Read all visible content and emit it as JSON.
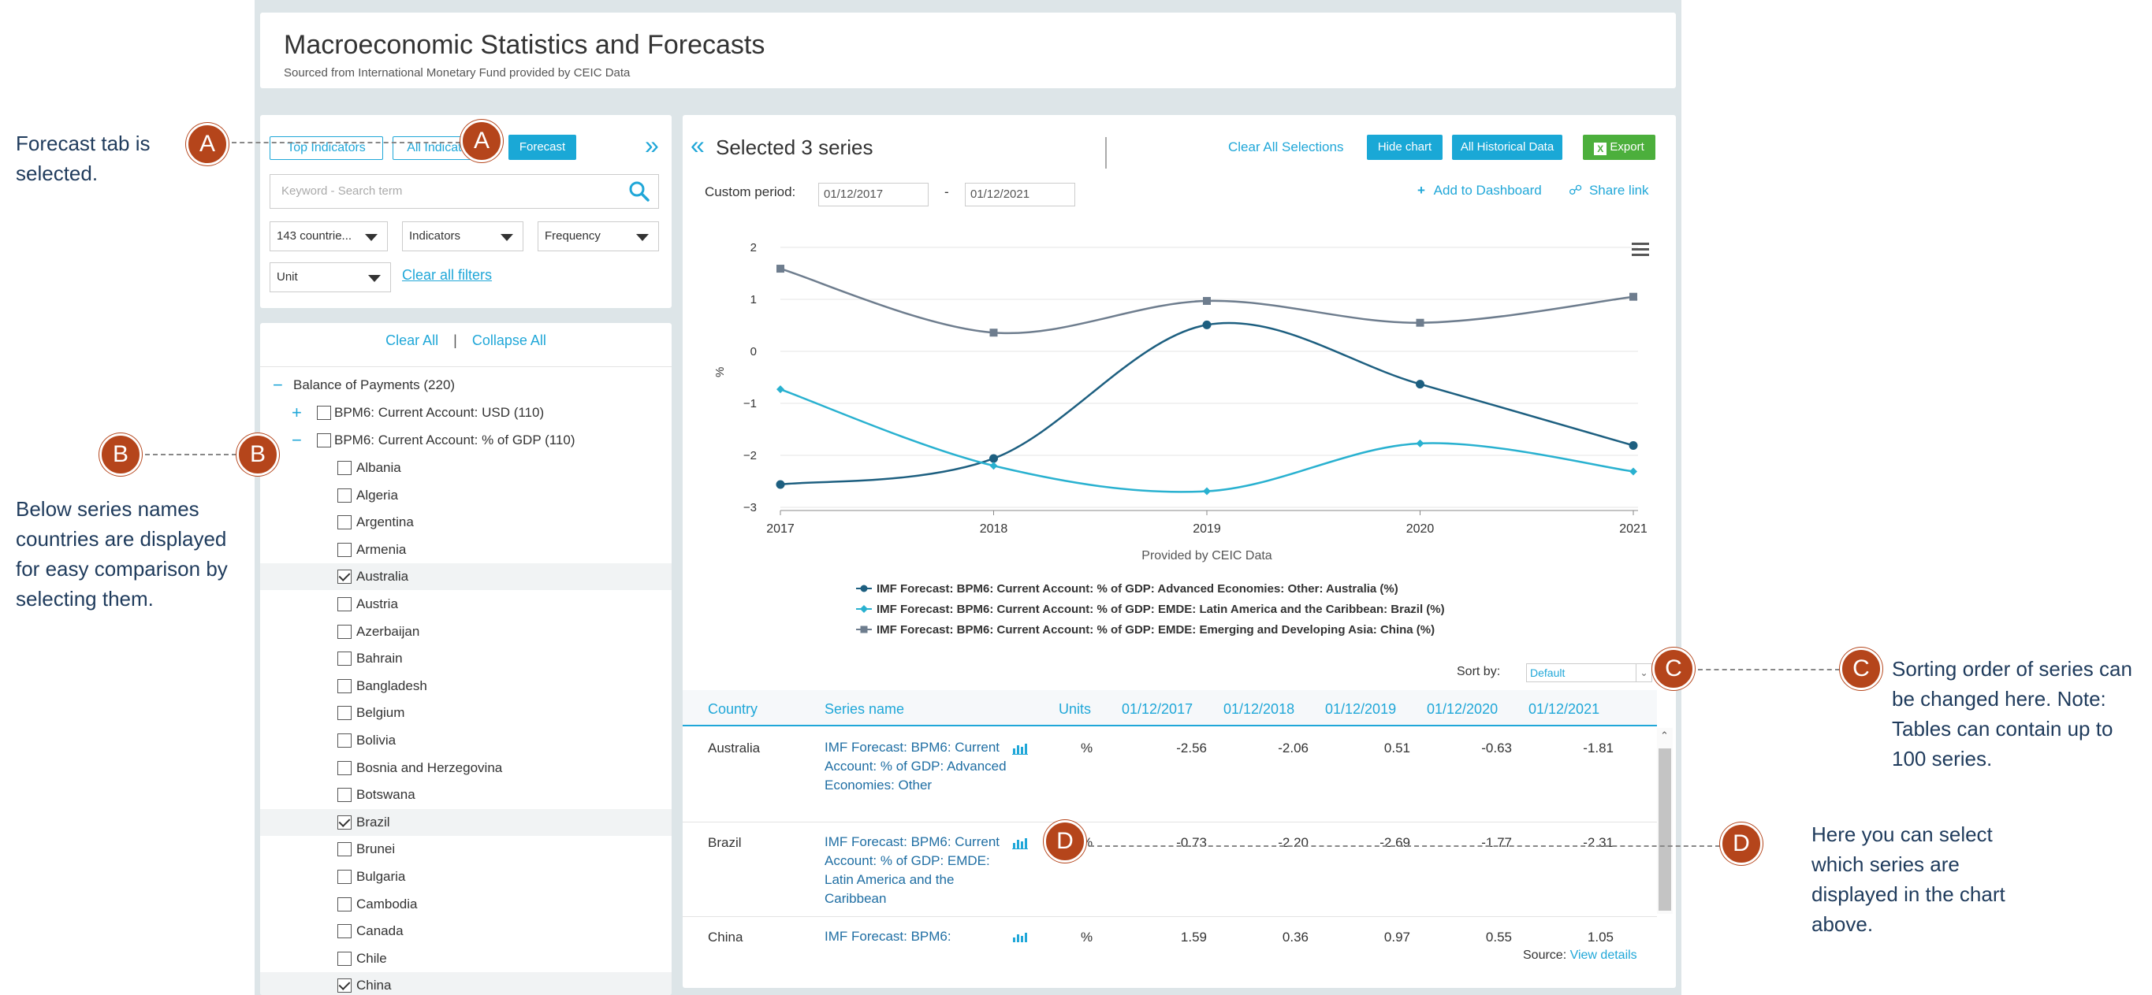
{
  "header": {
    "title": "Macroeconomic Statistics and Forecasts",
    "subtitle": "Sourced from International Monetary Fund provided by CEIC Data"
  },
  "filters": {
    "tabs": [
      "Top Indicators",
      "All Indicators",
      "Forecast"
    ],
    "search_placeholder": "Keyword - Search term",
    "country_select": "143 countrie...",
    "indicators_select": "Indicators",
    "frequency_select": "Frequency",
    "unit_select": "Unit",
    "clear_filters": "Clear all filters",
    "expand_glyph": "»"
  },
  "tree": {
    "clear_all": "Clear All",
    "separator": "|",
    "collapse_all": "Collapse All",
    "root": {
      "toggle": "−",
      "label": "Balance of Payments (220)"
    },
    "nodes": [
      {
        "toggle": "+",
        "label": "BPM6: Current Account: USD (110)"
      },
      {
        "toggle": "−",
        "label": "BPM6: Current Account: % of GDP (110)"
      }
    ],
    "countries": [
      {
        "name": "Albania",
        "checked": false
      },
      {
        "name": "Algeria",
        "checked": false
      },
      {
        "name": "Argentina",
        "checked": false
      },
      {
        "name": "Armenia",
        "checked": false
      },
      {
        "name": "Australia",
        "checked": true
      },
      {
        "name": "Austria",
        "checked": false
      },
      {
        "name": "Azerbaijan",
        "checked": false
      },
      {
        "name": "Bahrain",
        "checked": false
      },
      {
        "name": "Bangladesh",
        "checked": false
      },
      {
        "name": "Belgium",
        "checked": false
      },
      {
        "name": "Bolivia",
        "checked": false
      },
      {
        "name": "Bosnia and Herzegovina",
        "checked": false
      },
      {
        "name": "Botswana",
        "checked": false
      },
      {
        "name": "Brazil",
        "checked": true
      },
      {
        "name": "Brunei",
        "checked": false
      },
      {
        "name": "Bulgaria",
        "checked": false
      },
      {
        "name": "Cambodia",
        "checked": false
      },
      {
        "name": "Canada",
        "checked": false
      },
      {
        "name": "Chile",
        "checked": false
      },
      {
        "name": "China",
        "checked": true
      }
    ]
  },
  "main": {
    "collapse_glyph": "«",
    "selected_title": "Selected 3 series",
    "clear_all_selections": "Clear All Selections",
    "hide_chart": "Hide chart",
    "all_historical": "All Historical Data",
    "export": "Export",
    "custom_period_label": "Custom period:",
    "period_from": "01/12/2017",
    "period_dash": "-",
    "period_to": "01/12/2021",
    "add_to_dashboard": "Add to Dashboard",
    "share_link": "Share link",
    "sort_by_label": "Sort by:",
    "sort_value": "Default",
    "source_label": "Source:",
    "view_details": "View details"
  },
  "chart_data": {
    "type": "line",
    "x": [
      "2017",
      "2018",
      "2019",
      "2020",
      "2021"
    ],
    "ylabel": "%",
    "ylim": [
      -3,
      2
    ],
    "yticks": [
      "2",
      "1",
      "0",
      "−1",
      "−2",
      "−3"
    ],
    "footer": "Provided by CEIC Data",
    "series": [
      {
        "name": "IMF Forecast: BPM6: Current Account: % of GDP: Advanced Economies: Other: Australia (%)",
        "values": [
          -2.56,
          -2.06,
          0.51,
          -0.63,
          -1.81
        ],
        "color": "#1d5f80"
      },
      {
        "name": "IMF Forecast: BPM6: Current Account: % of GDP: EMDE: Latin America and the Caribbean: Brazil (%)",
        "values": [
          -0.73,
          -2.2,
          -2.69,
          -1.77,
          -2.31
        ],
        "color": "#29b1d0"
      },
      {
        "name": "IMF Forecast: BPM6: Current Account: % of GDP: EMDE: Emerging and Developing Asia: China (%)",
        "values": [
          1.59,
          0.36,
          0.97,
          0.55,
          1.05
        ],
        "color": "#6e7d8e"
      }
    ],
    "grid": true,
    "legend_position": "bottom"
  },
  "table": {
    "headers": [
      "Country",
      "Series name",
      "Units",
      "01/12/2017",
      "01/12/2018",
      "01/12/2019",
      "01/12/2020",
      "01/12/2021"
    ],
    "rows": [
      {
        "country": "Australia",
        "series": "IMF Forecast: BPM6: Current Account: % of GDP: Advanced Economies: Other",
        "unit": "%",
        "values": [
          "-2.56",
          "-2.06",
          "0.51",
          "-0.63",
          "-1.81"
        ]
      },
      {
        "country": "Brazil",
        "series": "IMF Forecast: BPM6: Current Account: % of GDP: EMDE: Latin America and the Caribbean",
        "unit": "%",
        "values": [
          "-0.73",
          "-2.20",
          "-2.69",
          "-1.77",
          "-2.31"
        ]
      },
      {
        "country": "China",
        "series": "IMF Forecast: BPM6:",
        "unit": "%",
        "values": [
          "1.59",
          "0.36",
          "0.97",
          "0.55",
          "1.05"
        ]
      }
    ]
  },
  "annotations": {
    "a_letter": "A",
    "b_letter": "B",
    "c_letter": "C",
    "d_letter": "D",
    "a_text": "Forecast tab is selected.",
    "b_text": "Below series names countries are displayed for easy comparison by selecting them.",
    "c_text": "Sorting order of series can be changed here. Note: Tables can contain up to 100 series.",
    "d_text": "Here you can select which series are displayed in the chart above."
  },
  "colors": {
    "accent": "#1aa8d6",
    "export": "#4caf3c",
    "annot": "#b5451b"
  }
}
